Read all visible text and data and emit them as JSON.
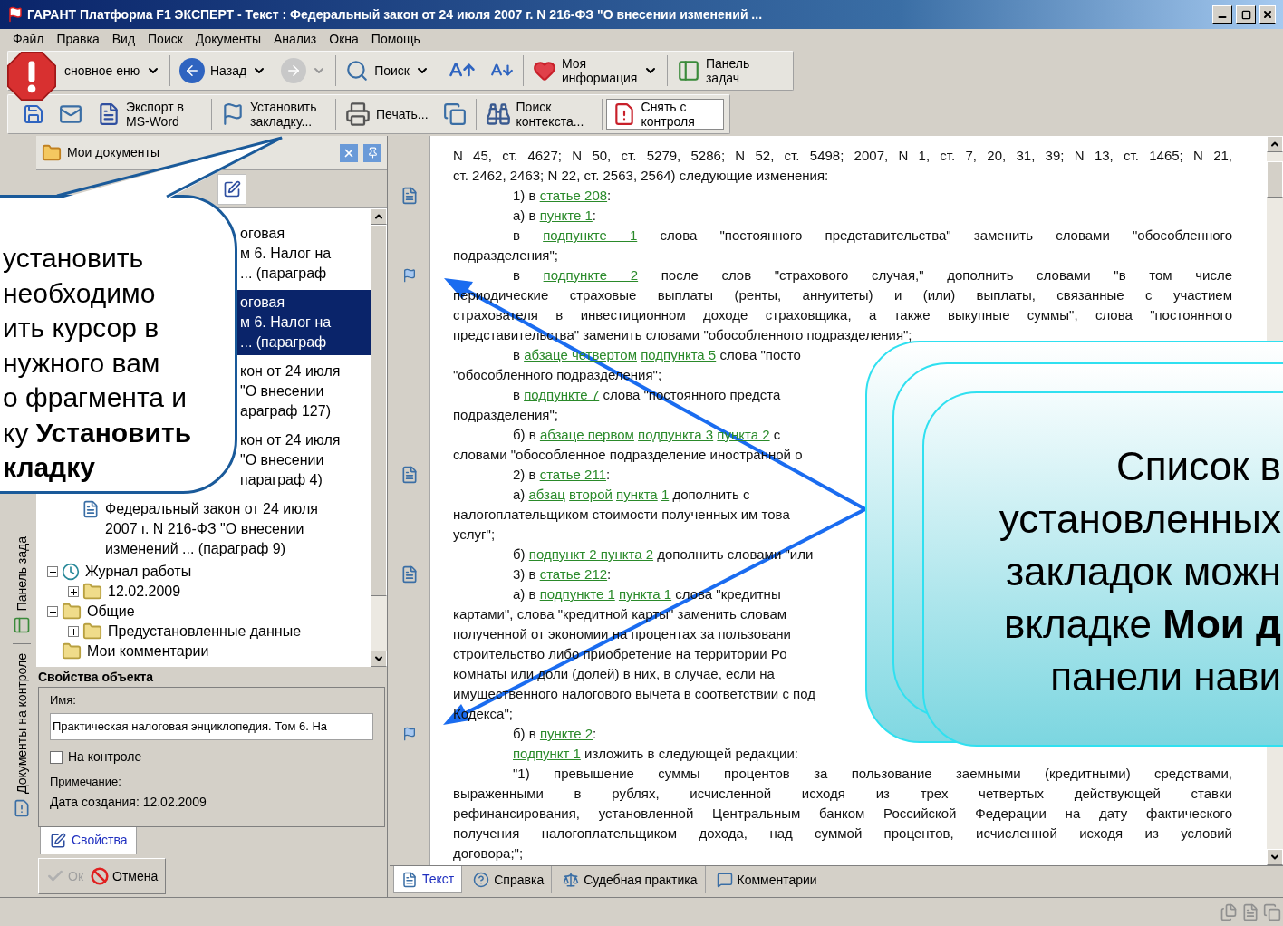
{
  "window": {
    "title": "ГАРАНТ Платформа F1 ЭКСПЕРТ - Текст : Федеральный закон от 24 июля 2007 г. N 216-ФЗ \"О внесении изменений ..."
  },
  "menu": [
    "Файл",
    "Правка",
    "Вид",
    "Поиск",
    "Документы",
    "Анализ",
    "Окна",
    "Помощь"
  ],
  "toolbar_rows": [
    [
      {
        "label": "сновное еню",
        "dropdown": true
      },
      {
        "label": "Назад",
        "dropdown": true
      },
      {
        "kind": "icon",
        "disabled": true,
        "dropdown": true
      },
      {
        "label": "Поиск",
        "dropdown": true
      },
      {
        "kind": "icon"
      },
      {
        "kind": "icon"
      },
      {
        "label": "Моя информация",
        "dropdown": true
      },
      {
        "label": "Панель задач"
      }
    ],
    [
      {
        "kind": "icon"
      },
      {
        "kind": "icon"
      },
      {
        "label": "Экспорт в MS-Word"
      },
      {
        "label": "Установить закладку..."
      },
      {
        "label": "Печать..."
      },
      {
        "kind": "icon"
      },
      {
        "label": "Поиск контекста..."
      },
      {
        "label": "Снять с контроля",
        "pressed": true
      }
    ]
  ],
  "side_tabs": [
    "Панель зада",
    "Документы на контроле"
  ],
  "panel": {
    "title": "Мои документы"
  },
  "tree": {
    "items": [
      {
        "kind": "bookmark",
        "selected": false,
        "lines": [
          "оговая",
          "м 6. Налог на",
          "... (параграф"
        ]
      },
      {
        "kind": "bookmark",
        "selected": true,
        "lines": [
          "оговая",
          "м 6. Налог на",
          "... (параграф"
        ]
      },
      {
        "kind": "bookmark",
        "selected": false,
        "lines": [
          "кон от 24 июля",
          "\"О внесении",
          "араграф 127)"
        ]
      },
      {
        "kind": "bookmark",
        "selected": false,
        "lines": [
          "кон от 24 июля",
          "\"О внесении",
          "параграф 4)"
        ]
      },
      {
        "kind": "document",
        "selected": false,
        "lines": [
          "Федеральный закон от 24 июля",
          "2007 г. N 216-ФЗ \"О внесении",
          "изменений ... (параграф 9)"
        ]
      },
      {
        "kind": "log",
        "selected": false,
        "label": "Журнал работы",
        "expanded": true,
        "children": [
          {
            "kind": "folder",
            "selected": false,
            "label": "12.02.2009",
            "expanded": false
          }
        ]
      },
      {
        "kind": "folder",
        "selected": false,
        "label": "Общие",
        "expanded": true,
        "children": [
          {
            "kind": "folder",
            "selected": false,
            "label": "Предустановленные данные",
            "expanded": false
          }
        ]
      },
      {
        "kind": "folder",
        "selected": false,
        "label": "Мои комментарии"
      }
    ]
  },
  "props": {
    "title": "Свойства объекта",
    "name_label": "Имя:",
    "name_value": "Практическая налоговая энциклопедия. Том 6. На",
    "on_control": {
      "label": "На контроле",
      "checked": false
    },
    "note_label": "Примечание:",
    "created": "Дата создания: 12.02.2009",
    "tabs": [
      {
        "label": "Свойства",
        "selected": true
      }
    ],
    "buttons": [
      {
        "label": "Ок",
        "disabled": true
      },
      {
        "label": "Отмена",
        "disabled": false
      }
    ]
  },
  "document": {
    "lines": [
      {
        "justify": true,
        "parts": [
          {
            "text": "N 45, ст. 4627; N 50, ст. 5279, 5286; N 52, ст. 5498; 2007, N 1, ст. 7, 20, 31, 39; N 13, ст. 1465; N 21,"
          }
        ]
      },
      {
        "parts": [
          {
            "text": "ст. 2462, 2463; N 22, ст. 2563, 2564) следующие изменения:"
          }
        ]
      },
      {
        "indent": true,
        "section_mark": true,
        "parts": [
          {
            "text": "1) в "
          },
          {
            "text": "статье 208",
            "link": true
          },
          {
            "text": ":"
          }
        ]
      },
      {
        "indent": true,
        "parts": [
          {
            "text": "а) в "
          },
          {
            "text": "пункте 1",
            "link": true
          },
          {
            "text": ":"
          }
        ]
      },
      {
        "indent": true,
        "justify": true,
        "parts": [
          {
            "text": "в "
          },
          {
            "text": "подпункте 1",
            "link": true
          },
          {
            "text": " слова \"постоянного представительства\" заменить словами \"обособленного"
          }
        ]
      },
      {
        "parts": [
          {
            "text": "подразделения\";"
          }
        ]
      },
      {
        "indent": true,
        "justify": true,
        "bookmark": true,
        "parts": [
          {
            "text": "в "
          },
          {
            "text": "подпункте 2",
            "link": true
          },
          {
            "text": " после слов \"страхового случая,\" дополнить словами \"в том числе"
          }
        ]
      },
      {
        "justify": true,
        "parts": [
          {
            "text": "периодические страховые выплаты (ренты, аннуитеты) и (или) выплаты, связанные с участием"
          }
        ]
      },
      {
        "justify": true,
        "parts": [
          {
            "text": "страхователя в инвестиционном доходе страховщика, а также выкупные суммы\", слова \"постоянного"
          }
        ]
      },
      {
        "parts": [
          {
            "text": "представительства\" заменить словами \"обособленного подразделения\";"
          }
        ]
      },
      {
        "indent": true,
        "parts": [
          {
            "text": "в "
          },
          {
            "text": "абзаце четвертом",
            "link": true
          },
          {
            "text": "подпункта 5",
            "link": true
          },
          {
            "text": " слова \"посто"
          }
        ]
      },
      {
        "parts": [
          {
            "text": "\"обособленного подразделения\";"
          }
        ]
      },
      {
        "indent": true,
        "parts": [
          {
            "text": "в "
          },
          {
            "text": "подпункте 7",
            "link": true
          },
          {
            "text": " слова \"постоянного предста"
          }
        ]
      },
      {
        "parts": [
          {
            "text": "подразделения\";"
          }
        ]
      },
      {
        "indent": true,
        "parts": [
          {
            "text": "б) в "
          },
          {
            "text": "абзаце первом",
            "link": true
          },
          {
            "text": "подпункта 3",
            "link": true
          },
          {
            "text": "пункта 2",
            "link": true
          },
          {
            "text": " с"
          }
        ]
      },
      {
        "parts": [
          {
            "text": "словами \"обособленное подразделение иностранной о"
          }
        ]
      },
      {
        "indent": true,
        "section_mark": true,
        "parts": [
          {
            "text": "2) в "
          },
          {
            "text": "статье 211",
            "link": true
          },
          {
            "text": ":"
          }
        ]
      },
      {
        "indent": true,
        "parts": [
          {
            "text": "а) "
          },
          {
            "text": "абзац",
            "link": true
          },
          {
            "text": "второй",
            "link": true
          },
          {
            "text": "пункта",
            "link": true
          },
          {
            "text": "1",
            "link": true
          },
          {
            "text": " дополнить с"
          }
        ]
      },
      {
        "parts": [
          {
            "text": "налогоплательщиком стоимости полученных им това"
          }
        ]
      },
      {
        "parts": [
          {
            "text": "услуг\";"
          }
        ]
      },
      {
        "indent": true,
        "parts": [
          {
            "text": "б) "
          },
          {
            "text": "подпункт 2 пункта 2",
            "link": true
          },
          {
            "text": " дополнить словами \"или"
          }
        ]
      },
      {
        "indent": true,
        "section_mark": true,
        "parts": [
          {
            "text": "3) в "
          },
          {
            "text": "статье 212",
            "link": true
          },
          {
            "text": ":"
          }
        ]
      },
      {
        "indent": true,
        "parts": [
          {
            "text": "а) в "
          },
          {
            "text": "подпункте 1",
            "link": true
          },
          {
            "text": "пункта 1",
            "link": true
          },
          {
            "text": " слова \"кредитны"
          }
        ]
      },
      {
        "parts": [
          {
            "text": "картами\", слова \"кредитной карты\" заменить словам"
          }
        ]
      },
      {
        "parts": [
          {
            "text": "полученной от экономии на процентах за пользовани"
          }
        ]
      },
      {
        "parts": [
          {
            "text": "строительство либо приобретение на территории Ро"
          }
        ]
      },
      {
        "parts": [
          {
            "text": "комнаты или доли (долей) в них, в случае, если на"
          }
        ]
      },
      {
        "parts": [
          {
            "text": "имущественного налогового вычета в соответствии с под"
          }
        ]
      },
      {
        "parts": [
          {
            "text": "Кодекса\";"
          }
        ]
      },
      {
        "indent": true,
        "bookmark": true,
        "parts": [
          {
            "text": "б) в "
          },
          {
            "text": "пункте 2",
            "link": true
          },
          {
            "text": ":"
          }
        ]
      },
      {
        "indent": true,
        "parts": [
          {
            "text": "подпункт 1",
            "link": true
          },
          {
            "text": " изложить в следующей редакции:"
          }
        ]
      },
      {
        "indent": true,
        "justify": true,
        "parts": [
          {
            "text": "\"1) превышение суммы процентов за пользование заемными (кредитными) средствами,"
          }
        ]
      },
      {
        "justify": true,
        "parts": [
          {
            "text": "выраженными в рублях, исчисленной исходя из трех четвертых действующей ставки"
          }
        ]
      },
      {
        "justify": true,
        "parts": [
          {
            "text": "рефинансирования, установленной Центральным банком Российской Федерации на дату фактического"
          }
        ]
      },
      {
        "justify": true,
        "parts": [
          {
            "text": "получения налогоплательщиком дохода, над суммой процентов, исчисленной исходя из условий"
          }
        ]
      },
      {
        "parts": [
          {
            "text": "договора;\";"
          }
        ]
      }
    ]
  },
  "doc_tabs": [
    {
      "label": "Текст",
      "selected": true
    },
    {
      "label": "Справка",
      "selected": false
    },
    {
      "label": "Судебная практика",
      "selected": false
    },
    {
      "label": "Комментарии",
      "selected": false
    }
  ],
  "callouts": [
    {
      "lines": [
        "установить",
        " необходимо",
        "ить курсор в",
        "нужного вам",
        "о фрагмента и",
        "ку **Установить**",
        "**кладку**"
      ]
    },
    {
      "lines": [
        "Список в",
        "установленных",
        "закладок можн",
        "вкладке **Мои д**",
        "панели нави"
      ]
    }
  ]
}
